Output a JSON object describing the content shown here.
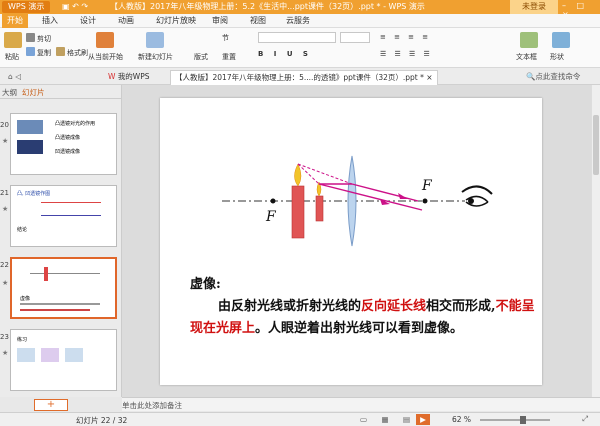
{
  "app": {
    "badge": "WPS 演示",
    "doc_title": "【人教版】2017年八年级物理上册：5.2《生活中...ppt课件（32页）.ppt * - WPS 演示",
    "login": "未登录",
    "window_controls": "– □ ×"
  },
  "menu": [
    "开始",
    "插入",
    "设计",
    "动画",
    "幻灯片放映",
    "审阅",
    "视图",
    "云服务"
  ],
  "ribbon": {
    "paste": "粘贴",
    "cut": "剪切",
    "copy": "复制",
    "format_painter": "格式刷",
    "play_current": "从当前开始",
    "new_slide": "新建幻灯片",
    "layout": "版式",
    "section": "节",
    "reset": "重置",
    "textbox": "文本框",
    "shape": "形状"
  },
  "tabs": {
    "my_wps": "我的WPS",
    "doc": "【人教版】2017年八年级物理上册：5....的透镜》ppt课件（32页）.ppt *",
    "hint": "点此查找命令"
  },
  "sidebar": {
    "tab_outline": "大纲",
    "tab_slides": "幻灯片",
    "thumbs": [
      {
        "num": "20",
        "caption_lines": [
          "凸透镜对光的作用",
          "凸透镜成像",
          "凹透镜成像"
        ]
      },
      {
        "num": "21",
        "caption_lines": [
          "凸, 凹透镜作图",
          "结论"
        ]
      },
      {
        "num": "22",
        "caption_lines": [
          "虚像"
        ]
      },
      {
        "num": "23",
        "caption_lines": [
          "练习"
        ]
      }
    ],
    "add_label": "+"
  },
  "slide": {
    "label_f_left": "F",
    "label_f_right": "F",
    "heading": "虚像:",
    "para_part1": "由反射光线或折射光线的",
    "para_red1": "反向延长线",
    "para_part2": "相交而形成,",
    "para_red2": "不能呈现在光屏上",
    "para_part3": "。人眼逆着出射光线可以看到虚像。"
  },
  "notes": {
    "placeholder": "单击此处添加备注"
  },
  "status": {
    "slide_counter": "幻灯片 22 / 32",
    "zoom": "62 %"
  },
  "colors": {
    "accent": "#f0a030",
    "ray": "#cc1188",
    "text_red": "#d01010"
  }
}
